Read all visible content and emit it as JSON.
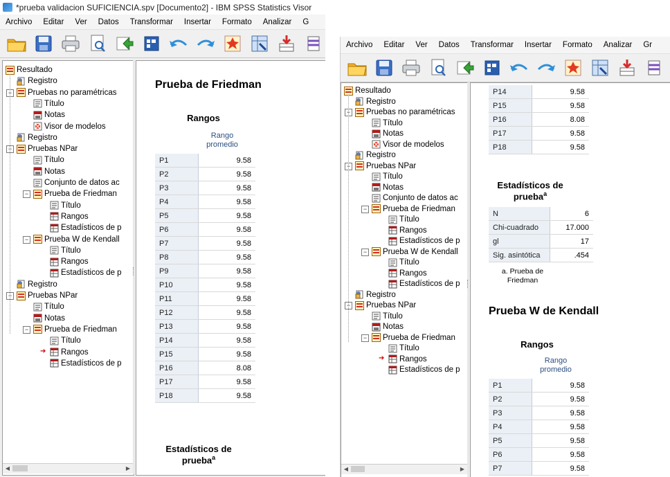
{
  "window1": {
    "title": "*prueba validacion SUFICIENCIA.spv [Documento2] - IBM SPSS Statistics Visor",
    "menu": [
      "Archivo",
      "Editar",
      "Ver",
      "Datos",
      "Transformar",
      "Insertar",
      "Formato",
      "Analizar",
      "G"
    ]
  },
  "window2": {
    "menu": [
      "Archivo",
      "Editar",
      "Ver",
      "Datos",
      "Transformar",
      "Insertar",
      "Formato",
      "Analizar",
      "Gr"
    ]
  },
  "toolbar_icons": [
    "open-icon",
    "save-icon",
    "print-icon",
    "print-preview-icon",
    "export-icon",
    "goto-data-icon",
    "undo-icon",
    "redo-icon",
    "goto-case-icon",
    "goto-variable-icon",
    "insert-cases-icon",
    "insert-variable-icon"
  ],
  "tree": {
    "resultado": "Resultado",
    "registro": "Registro",
    "pruebas_no_parametricas": "Pruebas no paramétricas",
    "titulo": "Título",
    "notas": "Notas",
    "visor_modelos": "Visor de modelos",
    "pruebas_npar": "Pruebas NPar",
    "conjunto": "Conjunto de datos ac",
    "friedman": "Prueba de Friedman",
    "rangos": "Rangos",
    "estadisticos": "Estadísticos de p",
    "kendall": "Prueba W de Kendall"
  },
  "output": {
    "friedman_title": "Prueba de Friedman",
    "kendall_title": "Prueba W de Kendall",
    "rangos_title": "Rangos",
    "rango_col_line1": "Rango",
    "rango_col_line2": "promedio",
    "estad_line1": "Estadísticos de",
    "estad_line2": "prueba",
    "footnote_mark": "a",
    "footnote_line1": "a. Prueba de",
    "footnote_line2": "Friedman"
  },
  "ranks_all": [
    {
      "label": "P1",
      "value": "9.58"
    },
    {
      "label": "P2",
      "value": "9.58"
    },
    {
      "label": "P3",
      "value": "9.58"
    },
    {
      "label": "P4",
      "value": "9.58"
    },
    {
      "label": "P5",
      "value": "9.58"
    },
    {
      "label": "P6",
      "value": "9.58"
    },
    {
      "label": "P7",
      "value": "9.58"
    },
    {
      "label": "P8",
      "value": "9.58"
    },
    {
      "label": "P9",
      "value": "9.58"
    },
    {
      "label": "P10",
      "value": "9.58"
    },
    {
      "label": "P11",
      "value": "9.58"
    },
    {
      "label": "P12",
      "value": "9.58"
    },
    {
      "label": "P13",
      "value": "9.58"
    },
    {
      "label": "P14",
      "value": "9.58"
    },
    {
      "label": "P15",
      "value": "9.58"
    },
    {
      "label": "P16",
      "value": "8.08"
    },
    {
      "label": "P17",
      "value": "9.58"
    },
    {
      "label": "P18",
      "value": "9.58"
    }
  ],
  "ranks_top_w2": [
    {
      "label": "P14",
      "value": "9.58"
    },
    {
      "label": "P15",
      "value": "9.58"
    },
    {
      "label": "P16",
      "value": "8.08"
    },
    {
      "label": "P17",
      "value": "9.58"
    },
    {
      "label": "P18",
      "value": "9.58"
    }
  ],
  "ranks_kendall_w2": [
    {
      "label": "P1",
      "value": "9.58"
    },
    {
      "label": "P2",
      "value": "9.58"
    },
    {
      "label": "P3",
      "value": "9.58"
    },
    {
      "label": "P4",
      "value": "9.58"
    },
    {
      "label": "P5",
      "value": "9.58"
    },
    {
      "label": "P6",
      "value": "9.58"
    },
    {
      "label": "P7",
      "value": "9.58"
    }
  ],
  "test_stats": [
    {
      "label": "N",
      "value": "6"
    },
    {
      "label": "Chi-cuadrado",
      "value": "17.000"
    },
    {
      "label": "gl",
      "value": "17"
    },
    {
      "label": "Sig. asintótica",
      "value": ".454"
    }
  ]
}
